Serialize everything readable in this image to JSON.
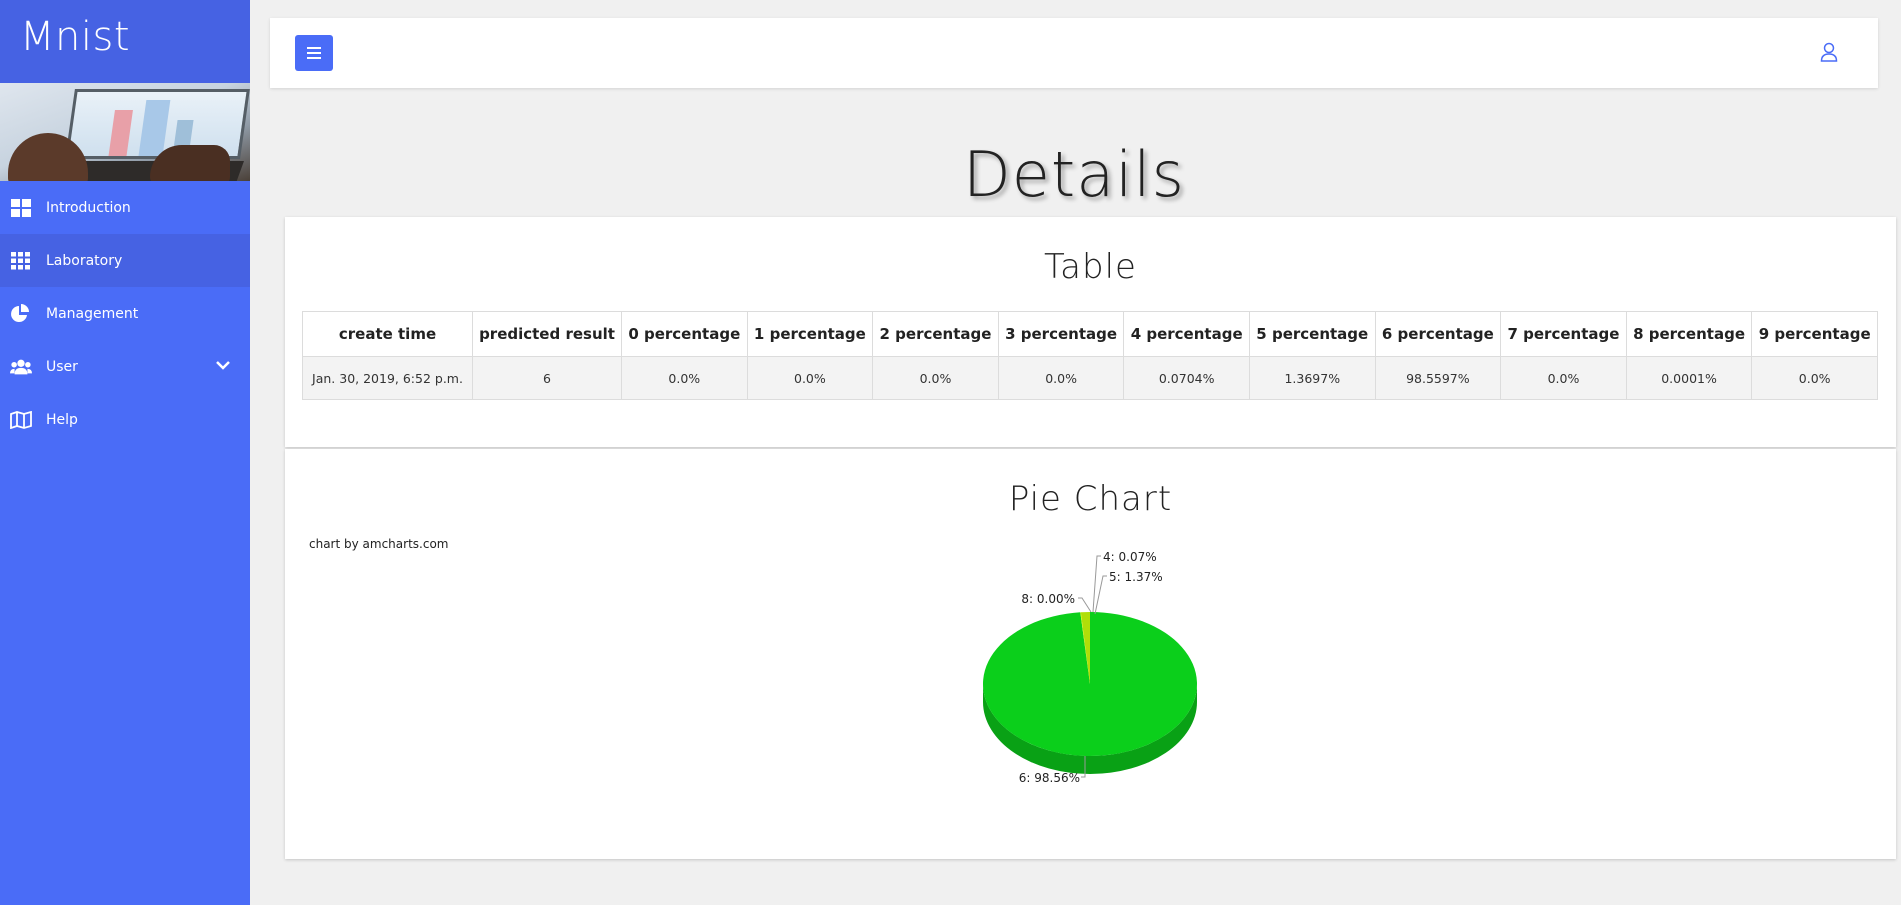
{
  "app": {
    "title": "Mnist"
  },
  "sidebar": {
    "items": [
      {
        "label": "Introduction",
        "icon": "dashboard-icon"
      },
      {
        "label": "Laboratory",
        "icon": "grid-icon",
        "active": true
      },
      {
        "label": "Management",
        "icon": "pie-icon"
      },
      {
        "label": "User",
        "icon": "users-icon",
        "has_submenu": true
      },
      {
        "label": "Help",
        "icon": "map-icon"
      }
    ]
  },
  "header": {
    "menu_icon": "hamburger-icon",
    "user_icon": "user-icon"
  },
  "page": {
    "title": "Details"
  },
  "table_section": {
    "title": "Table",
    "columns": [
      "create time",
      "predicted result",
      "0 percentage",
      "1 percentage",
      "2 percentage",
      "3 percentage",
      "4 percentage",
      "5 percentage",
      "6 percentage",
      "7 percentage",
      "8 percentage",
      "9 percentage"
    ],
    "rows": [
      [
        "Jan. 30, 2019, 6:52 p.m.",
        "6",
        "0.0%",
        "0.0%",
        "0.0%",
        "0.0%",
        "0.0704%",
        "1.3697%",
        "98.5597%",
        "0.0%",
        "0.0001%",
        "0.0%"
      ]
    ]
  },
  "pie_section": {
    "title": "Pie Chart",
    "credit": "chart by amcharts.com"
  },
  "chart_data": {
    "type": "pie",
    "title": "",
    "slices": [
      {
        "label": "6: 98.56%",
        "category": "6",
        "value": 98.5597,
        "color": "#0bcf1b"
      },
      {
        "label": "5: 1.37%",
        "category": "5",
        "value": 1.3697,
        "color": "#b0de09"
      },
      {
        "label": "4: 0.07%",
        "category": "4",
        "value": 0.0704,
        "color": "#f8ff01"
      },
      {
        "label": "8: 0.00%",
        "category": "8",
        "value": 0.0001,
        "color": "#04d215"
      }
    ],
    "style": "3d"
  },
  "colors": {
    "accent": "#4a6cf7",
    "sidebar_dark": "#4662e3",
    "background": "#f0f0f0"
  }
}
